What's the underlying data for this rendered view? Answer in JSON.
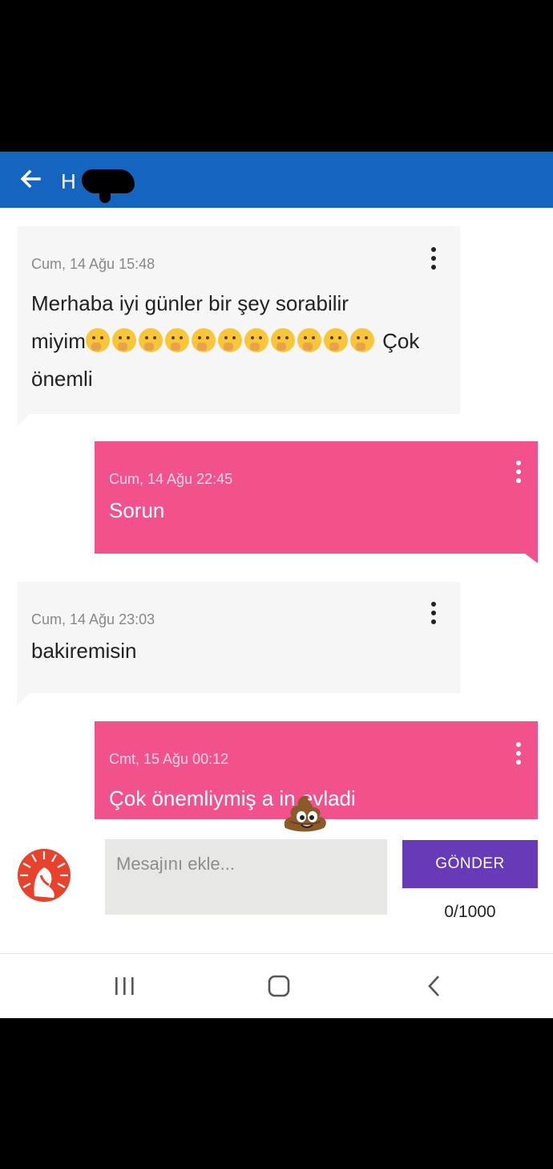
{
  "header": {
    "title": "H          9",
    "back_icon": "arrow-left-icon"
  },
  "messages": [
    {
      "direction": "incoming",
      "date": "Cum, 14 Ağu 15:48",
      "line1": "Merhaba iyi günler bir şey sorabilir",
      "line2_prefix": "miyim",
      "emoji": "thinking-face-hand-over-mouth-icon",
      "emoji_count": 11,
      "line2_suffix": " Çok",
      "line3": "önemli"
    },
    {
      "direction": "outgoing",
      "date": "Cum, 14 Ağu 22:45",
      "text": "Sorun"
    },
    {
      "direction": "incoming",
      "date": "Cum, 14 Ağu 23:03",
      "text": "bakiremisin"
    },
    {
      "direction": "outgoing",
      "date": "Cmt, 15 Ağu 00:12",
      "text": "Çok önemliymiş a   in evladi"
    }
  ],
  "composer": {
    "placeholder": "Mesajını ekle...",
    "send_label": "GÖNDER",
    "counter": "0/1000"
  },
  "colors": {
    "appbar": "#1565c0",
    "incoming_bubble": "#f6f6f6",
    "outgoing_bubble": "#f2528c",
    "send_button": "#673ab7"
  },
  "navigation": {
    "icons": [
      "recent-apps-icon",
      "home-icon",
      "back-chevron-icon"
    ]
  }
}
